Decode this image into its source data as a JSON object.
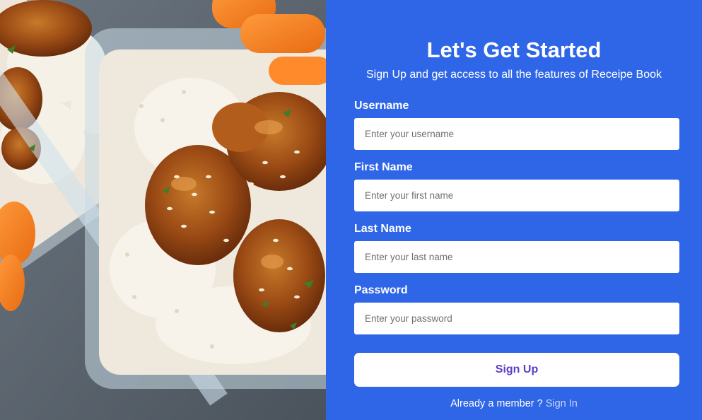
{
  "hero_image": {
    "alt_icon": "food-photo"
  },
  "form": {
    "title": "Let's Get Started",
    "subtitle": "Sign Up and get access to all the features of Receipe Book",
    "fields": [
      {
        "label": "Username",
        "placeholder": "Enter your username",
        "value": ""
      },
      {
        "label": "First Name",
        "placeholder": "Enter your first name",
        "value": ""
      },
      {
        "label": "Last Name",
        "placeholder": "Enter your last name",
        "value": ""
      },
      {
        "label": "Password",
        "placeholder": "Enter your password",
        "value": ""
      }
    ],
    "submit_label": "Sign Up",
    "member_text": "Already a member ?",
    "signin_link": "Sign In"
  },
  "colors": {
    "panel_background": "#2f66e8",
    "button_text": "#5a3ec8",
    "link": "#c9d3f5"
  }
}
